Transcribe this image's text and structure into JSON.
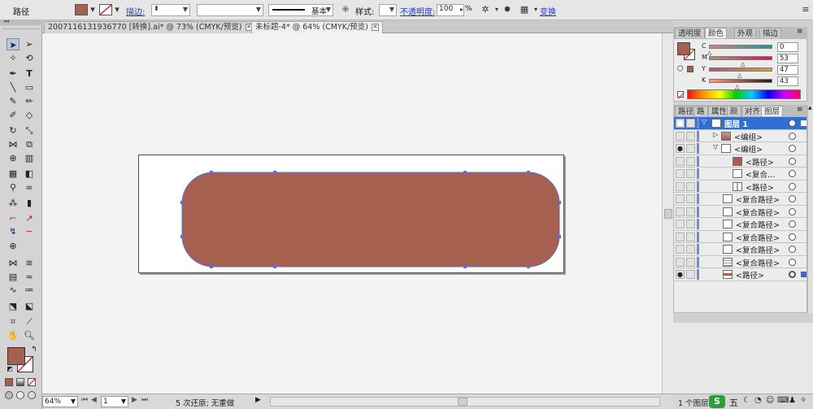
{
  "control_bar": {
    "object_type": "路径",
    "fill_color": "#a8614f",
    "stroke_label": "描边:",
    "stroke_weight_value": "",
    "variable_width_value": "",
    "brush_label": "基本",
    "style_label": "样式:",
    "opacity_label": "不透明度:",
    "opacity_value": "100",
    "opacity_unit": "%",
    "transform_label": "变换"
  },
  "tabs": [
    {
      "label": "2007116131936770 [转换].ai* @ 73% (CMYK/预览)",
      "active": false
    },
    {
      "label": "未标题-4* @ 64% (CMYK/预览)",
      "active": true
    }
  ],
  "shape": {
    "fill": "#a6604f",
    "stroke": "#5a6fd8",
    "anchor_color": "#5a6fd8"
  },
  "status_bar": {
    "zoom": "64%",
    "artboard_number": "1",
    "undo_text": "5 次还原; 无重做"
  },
  "color_panel": {
    "tabs": [
      "透明度",
      "颜色",
      "外观",
      "描边"
    ],
    "active_tab": "颜色",
    "fill_color": "#a6604f",
    "channels": [
      {
        "label": "C",
        "value": "0"
      },
      {
        "label": "M",
        "value": "53"
      },
      {
        "label": "Y",
        "value": "47"
      },
      {
        "label": "K",
        "value": "43"
      }
    ]
  },
  "layers_panel": {
    "tabs": [
      "路径",
      "路",
      "属性",
      "颜",
      "对齐",
      "图层"
    ],
    "active_tab": "图层",
    "footer_text": "1 个图层",
    "rows": [
      {
        "name": "图层 1",
        "selected": true,
        "eye": true
      },
      {
        "name": "<编组>",
        "selected": false,
        "eye": false
      },
      {
        "name": "<编组>",
        "selected": false,
        "eye": true
      },
      {
        "name": "<路径>",
        "selected": false,
        "eye": false
      },
      {
        "name": "<复合…",
        "selected": false,
        "eye": false
      },
      {
        "name": "<路径>",
        "selected": false,
        "eye": false
      },
      {
        "name": "<复合路径>",
        "selected": false,
        "eye": false
      },
      {
        "name": "<复合路径>",
        "selected": false,
        "eye": false
      },
      {
        "name": "<复合路径>",
        "selected": false,
        "eye": false
      },
      {
        "name": "<复合路径>",
        "selected": false,
        "eye": false
      },
      {
        "name": "<复合路径>",
        "selected": false,
        "eye": false
      },
      {
        "name": "<复合路径>",
        "selected": false,
        "eye": false
      },
      {
        "name": "<路径>",
        "selected": false,
        "eye": true
      }
    ]
  },
  "taskbar_ime": {
    "ime_char": "五"
  }
}
